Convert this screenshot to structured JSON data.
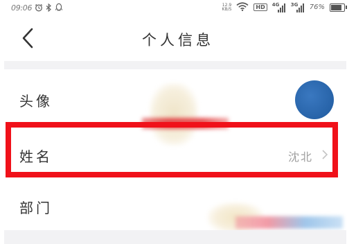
{
  "status_bar": {
    "time": "09:06",
    "speed_value": "12.9",
    "speed_unit": "KB/S",
    "hd_label": "HD",
    "net_4g": "4G",
    "net_3g": "3G",
    "battery_text": "76%",
    "battery_level": 0.76,
    "icons": [
      "alarm-icon",
      "bluetooth-icon",
      "qq-icon",
      "wifi-icon",
      "signal-icon",
      "battery-icon"
    ]
  },
  "nav": {
    "title": "个人信息",
    "back_icon": "back-arrow-icon"
  },
  "rows": {
    "avatar_label": "头像",
    "name_label": "姓名",
    "name_value": "沈北",
    "dept_label": "部门"
  },
  "colors": {
    "highlight": "#f0111a",
    "avatar": "#2a6bb3",
    "separator": "#f2f2f4"
  }
}
